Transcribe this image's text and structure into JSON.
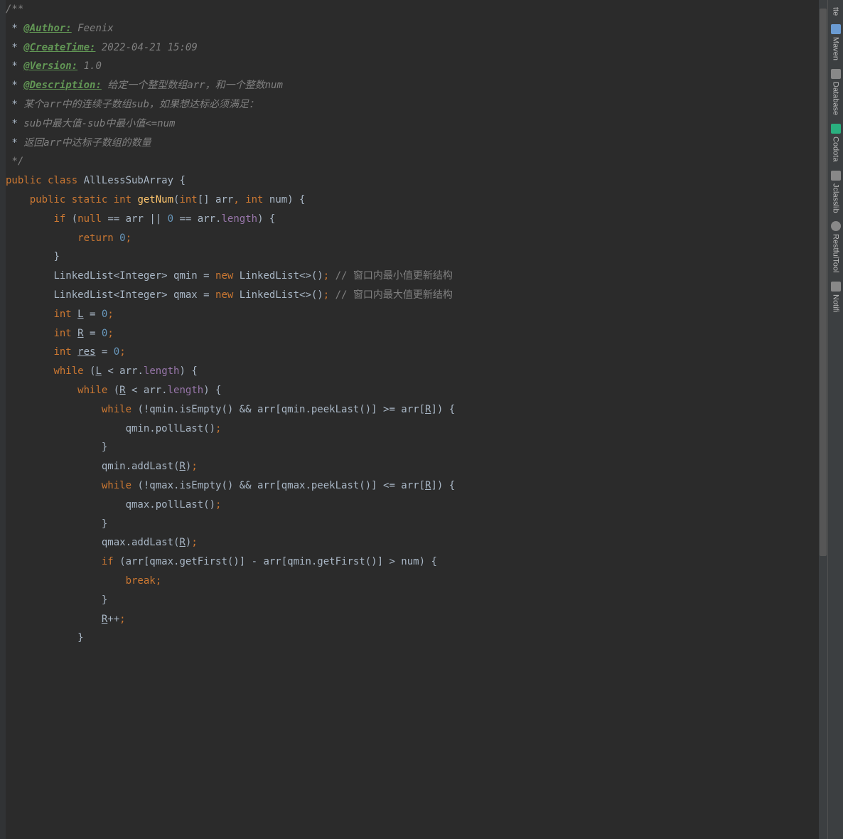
{
  "code": {
    "lines": [
      {
        "indent": "",
        "tokens": [
          {
            "t": "/**",
            "c": "kw-doc-text"
          }
        ]
      },
      {
        "indent": " * ",
        "tokens": [
          {
            "t": "@Author:",
            "c": "kw-doc-tag"
          },
          {
            "t": " Feenix",
            "c": "kw-doc-text"
          }
        ]
      },
      {
        "indent": " * ",
        "tokens": [
          {
            "t": "@CreateTime:",
            "c": "kw-doc-tag"
          },
          {
            "t": " 2022-04-21 15:09",
            "c": "kw-doc-text"
          }
        ]
      },
      {
        "indent": " * ",
        "tokens": [
          {
            "t": "@Version:",
            "c": "kw-doc-tag"
          },
          {
            "t": " 1.0",
            "c": "kw-doc-text"
          }
        ]
      },
      {
        "indent": " * ",
        "tokens": [
          {
            "t": "@Description:",
            "c": "kw-doc-tag"
          },
          {
            "t": " 给定一个整型数组arr，和一个整数num",
            "c": "kw-doc-text"
          }
        ]
      },
      {
        "indent": " * ",
        "tokens": [
          {
            "t": "某个arr中的连续子数组sub，如果想达标必须满足：",
            "c": "kw-doc-text"
          }
        ]
      },
      {
        "indent": " * ",
        "tokens": [
          {
            "t": "sub中最大值-sub中最小值<=num",
            "c": "kw-doc-text"
          }
        ]
      },
      {
        "indent": " * ",
        "tokens": [
          {
            "t": "返回arr中达标子数组的数量",
            "c": "kw-doc-text"
          }
        ]
      },
      {
        "indent": " ",
        "tokens": [
          {
            "t": "*/",
            "c": "kw-doc-text"
          }
        ]
      },
      {
        "indent": "",
        "tokens": [
          {
            "t": "public class ",
            "c": "kw-orange"
          },
          {
            "t": "AllLessSubArray {",
            "c": "kw-punct"
          }
        ]
      },
      {
        "indent": "",
        "tokens": [
          {
            "t": "",
            "c": ""
          }
        ]
      },
      {
        "indent": "    ",
        "tokens": [
          {
            "t": "public static int ",
            "c": "kw-orange"
          },
          {
            "t": "getNum",
            "c": "kw-method"
          },
          {
            "t": "(",
            "c": "kw-punct"
          },
          {
            "t": "int",
            "c": "kw-orange"
          },
          {
            "t": "[] arr",
            "c": "kw-punct"
          },
          {
            "t": ", ",
            "c": "kw-orange"
          },
          {
            "t": "int ",
            "c": "kw-orange"
          },
          {
            "t": "num) {",
            "c": "kw-punct"
          }
        ]
      },
      {
        "indent": "        ",
        "tokens": [
          {
            "t": "if ",
            "c": "kw-orange"
          },
          {
            "t": "(",
            "c": "kw-punct"
          },
          {
            "t": "null ",
            "c": "kw-orange"
          },
          {
            "t": "== arr || ",
            "c": "kw-punct"
          },
          {
            "t": "0 ",
            "c": "kw-number"
          },
          {
            "t": "== arr.",
            "c": "kw-punct"
          },
          {
            "t": "length",
            "c": "kw-field"
          },
          {
            "t": ") {",
            "c": "kw-punct"
          }
        ]
      },
      {
        "indent": "            ",
        "tokens": [
          {
            "t": "return ",
            "c": "kw-orange"
          },
          {
            "t": "0",
            "c": "kw-number"
          },
          {
            "t": ";",
            "c": "kw-orange"
          }
        ]
      },
      {
        "indent": "        ",
        "tokens": [
          {
            "t": "}",
            "c": "kw-punct"
          }
        ]
      },
      {
        "indent": "",
        "tokens": [
          {
            "t": "",
            "c": ""
          }
        ]
      },
      {
        "indent": "        ",
        "tokens": [
          {
            "t": "LinkedList<Integer> qmin = ",
            "c": "kw-punct"
          },
          {
            "t": "new ",
            "c": "kw-orange"
          },
          {
            "t": "LinkedList<>()",
            "c": "kw-punct"
          },
          {
            "t": "; ",
            "c": "kw-orange"
          },
          {
            "t": "// 窗口内最小值更新结构",
            "c": "kw-line-comment"
          }
        ]
      },
      {
        "indent": "        ",
        "tokens": [
          {
            "t": "LinkedList<Integer> qmax = ",
            "c": "kw-punct"
          },
          {
            "t": "new ",
            "c": "kw-orange"
          },
          {
            "t": "LinkedList<>()",
            "c": "kw-punct"
          },
          {
            "t": "; ",
            "c": "kw-orange"
          },
          {
            "t": "// 窗口内最大值更新结构",
            "c": "kw-line-comment"
          }
        ]
      },
      {
        "indent": "",
        "tokens": [
          {
            "t": "",
            "c": ""
          }
        ]
      },
      {
        "indent": "        ",
        "tokens": [
          {
            "t": "int ",
            "c": "kw-orange"
          },
          {
            "t": "L",
            "c": "kw-var-u"
          },
          {
            "t": " = ",
            "c": "kw-punct"
          },
          {
            "t": "0",
            "c": "kw-number"
          },
          {
            "t": ";",
            "c": "kw-orange"
          }
        ]
      },
      {
        "indent": "        ",
        "tokens": [
          {
            "t": "int ",
            "c": "kw-orange"
          },
          {
            "t": "R",
            "c": "kw-var-u"
          },
          {
            "t": " = ",
            "c": "kw-punct"
          },
          {
            "t": "0",
            "c": "kw-number"
          },
          {
            "t": ";",
            "c": "kw-orange"
          }
        ]
      },
      {
        "indent": "        ",
        "tokens": [
          {
            "t": "int ",
            "c": "kw-orange"
          },
          {
            "t": "res",
            "c": "kw-var-u"
          },
          {
            "t": " = ",
            "c": "kw-punct"
          },
          {
            "t": "0",
            "c": "kw-number"
          },
          {
            "t": ";",
            "c": "kw-orange"
          }
        ]
      },
      {
        "indent": "        ",
        "tokens": [
          {
            "t": "while ",
            "c": "kw-orange"
          },
          {
            "t": "(",
            "c": "kw-punct"
          },
          {
            "t": "L",
            "c": "kw-var-u"
          },
          {
            "t": " < arr.",
            "c": "kw-punct"
          },
          {
            "t": "length",
            "c": "kw-field"
          },
          {
            "t": ") {",
            "c": "kw-punct"
          }
        ]
      },
      {
        "indent": "            ",
        "tokens": [
          {
            "t": "while ",
            "c": "kw-orange"
          },
          {
            "t": "(",
            "c": "kw-punct"
          },
          {
            "t": "R",
            "c": "kw-var-u"
          },
          {
            "t": " < arr.",
            "c": "kw-punct"
          },
          {
            "t": "length",
            "c": "kw-field"
          },
          {
            "t": ") {",
            "c": "kw-punct"
          }
        ]
      },
      {
        "indent": "                ",
        "tokens": [
          {
            "t": "while ",
            "c": "kw-orange"
          },
          {
            "t": "(!qmin.isEmpty() && arr[qmin.peekLast()] >= arr[",
            "c": "kw-punct"
          },
          {
            "t": "R",
            "c": "kw-var-u"
          },
          {
            "t": "]) {",
            "c": "kw-punct"
          }
        ]
      },
      {
        "indent": "                    ",
        "tokens": [
          {
            "t": "qmin.pollLast()",
            "c": "kw-punct"
          },
          {
            "t": ";",
            "c": "kw-orange"
          }
        ]
      },
      {
        "indent": "                ",
        "tokens": [
          {
            "t": "}",
            "c": "kw-punct"
          }
        ]
      },
      {
        "indent": "                ",
        "tokens": [
          {
            "t": "qmin.addLast(",
            "c": "kw-punct"
          },
          {
            "t": "R",
            "c": "kw-var-u"
          },
          {
            "t": ")",
            "c": "kw-punct"
          },
          {
            "t": ";",
            "c": "kw-orange"
          }
        ]
      },
      {
        "indent": "",
        "tokens": [
          {
            "t": "",
            "c": ""
          }
        ]
      },
      {
        "indent": "                ",
        "tokens": [
          {
            "t": "while ",
            "c": "kw-orange"
          },
          {
            "t": "(!qmax.isEmpty() && arr[qmax.peekLast()] <= arr[",
            "c": "kw-punct"
          },
          {
            "t": "R",
            "c": "kw-var-u"
          },
          {
            "t": "]) {",
            "c": "kw-punct"
          }
        ]
      },
      {
        "indent": "                    ",
        "tokens": [
          {
            "t": "qmax.pollLast()",
            "c": "kw-punct"
          },
          {
            "t": ";",
            "c": "kw-orange"
          }
        ]
      },
      {
        "indent": "                ",
        "tokens": [
          {
            "t": "}",
            "c": "kw-punct"
          }
        ]
      },
      {
        "indent": "                ",
        "tokens": [
          {
            "t": "qmax.addLast(",
            "c": "kw-punct"
          },
          {
            "t": "R",
            "c": "kw-var-u"
          },
          {
            "t": ")",
            "c": "kw-punct"
          },
          {
            "t": ";",
            "c": "kw-orange"
          }
        ]
      },
      {
        "indent": "",
        "tokens": [
          {
            "t": "",
            "c": ""
          }
        ]
      },
      {
        "indent": "                ",
        "tokens": [
          {
            "t": "if ",
            "c": "kw-orange"
          },
          {
            "t": "(arr[qmax.getFirst()] - arr[qmin.getFirst()] > num) {",
            "c": "kw-punct"
          }
        ]
      },
      {
        "indent": "                    ",
        "tokens": [
          {
            "t": "break;",
            "c": "kw-orange"
          }
        ]
      },
      {
        "indent": "                ",
        "tokens": [
          {
            "t": "}",
            "c": "kw-punct"
          }
        ]
      },
      {
        "indent": "",
        "tokens": [
          {
            "t": "",
            "c": ""
          }
        ]
      },
      {
        "indent": "                ",
        "tokens": [
          {
            "t": "R",
            "c": "kw-var-u"
          },
          {
            "t": "++",
            "c": "kw-punct"
          },
          {
            "t": ";",
            "c": "kw-orange"
          }
        ]
      },
      {
        "indent": "            ",
        "tokens": [
          {
            "t": "}",
            "c": "kw-punct"
          }
        ]
      }
    ]
  },
  "toolwindows": [
    {
      "label": "tte",
      "icon": ""
    },
    {
      "label": "Maven",
      "icon": "icon-maven"
    },
    {
      "label": "Database",
      "icon": "icon-db"
    },
    {
      "label": "Codota",
      "icon": "icon-codota"
    },
    {
      "label": "Jclasslib",
      "icon": "icon-jclass"
    },
    {
      "label": "RestfulTool",
      "icon": "icon-rest"
    },
    {
      "label": "Notifi",
      "icon": "icon-notif"
    }
  ]
}
